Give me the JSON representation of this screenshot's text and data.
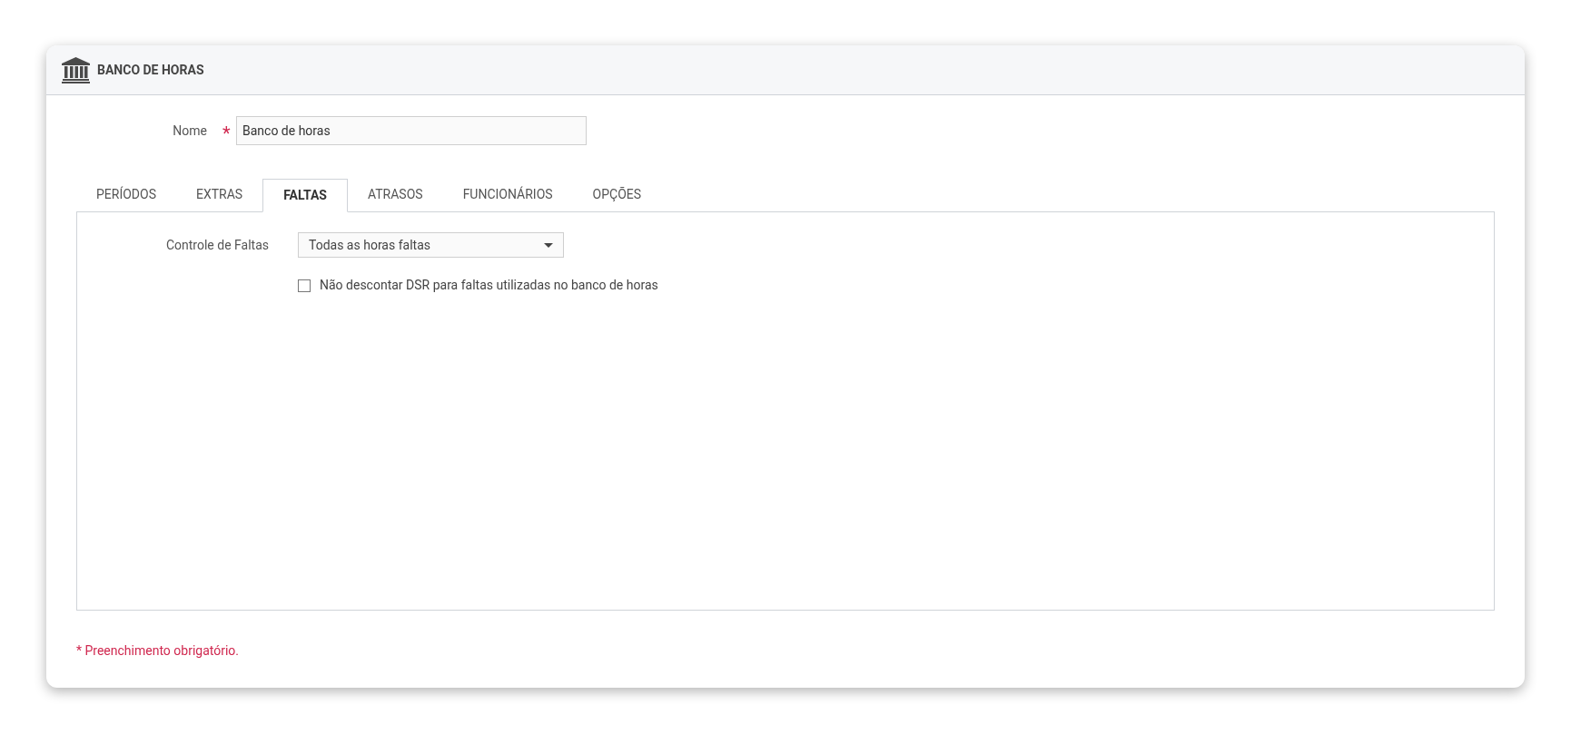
{
  "window": {
    "title": "BANCO DE HORAS"
  },
  "name_field": {
    "label": "Nome",
    "required_mark": "*",
    "value": "Banco de horas"
  },
  "tabs": [
    {
      "label": "PERÍODOS",
      "selected": false
    },
    {
      "label": "EXTRAS",
      "selected": false
    },
    {
      "label": "FALTAS",
      "selected": true
    },
    {
      "label": "ATRASOS",
      "selected": false
    },
    {
      "label": "FUNCIONÁRIOS",
      "selected": false
    },
    {
      "label": "OPÇÕES",
      "selected": false
    }
  ],
  "panel": {
    "control_label": "Controle de Faltas",
    "control_value": "Todas as horas faltas",
    "checkbox": {
      "label": "Não descontar DSR para faltas utilizadas no banco de horas",
      "checked": false
    }
  },
  "footer_note": "* Preenchimento obrigatório."
}
